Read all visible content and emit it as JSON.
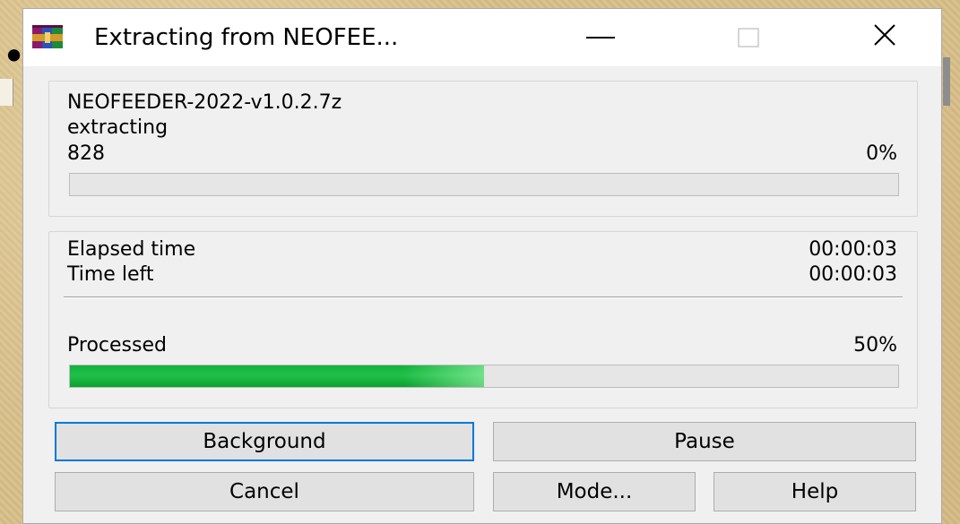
{
  "window": {
    "title": "Extracting from NEOFEE...",
    "controls": {
      "minimize": "minimize",
      "maximize": "maximize",
      "close": "close"
    }
  },
  "file_group": {
    "filename": "NEOFEEDER-2022-v1.0.2.7z",
    "status": "extracting",
    "current_item": "828",
    "file_percent": "0%",
    "file_progress": 0
  },
  "time_group": {
    "elapsed_label": "Elapsed time",
    "elapsed_value": "00:00:03",
    "left_label": "Time left",
    "left_value": "00:00:03",
    "processed_label": "Processed",
    "processed_percent": "50%",
    "processed_progress": 0.5
  },
  "buttons": {
    "background": "Background",
    "pause": "Pause",
    "cancel": "Cancel",
    "mode": "Mode...",
    "help": "Help"
  },
  "colors": {
    "progress_green": "#0fb13a",
    "default_button_border": "#0078d7",
    "window_bg": "#f0f0f0"
  },
  "icons": {
    "app": "winrar-books-icon"
  }
}
